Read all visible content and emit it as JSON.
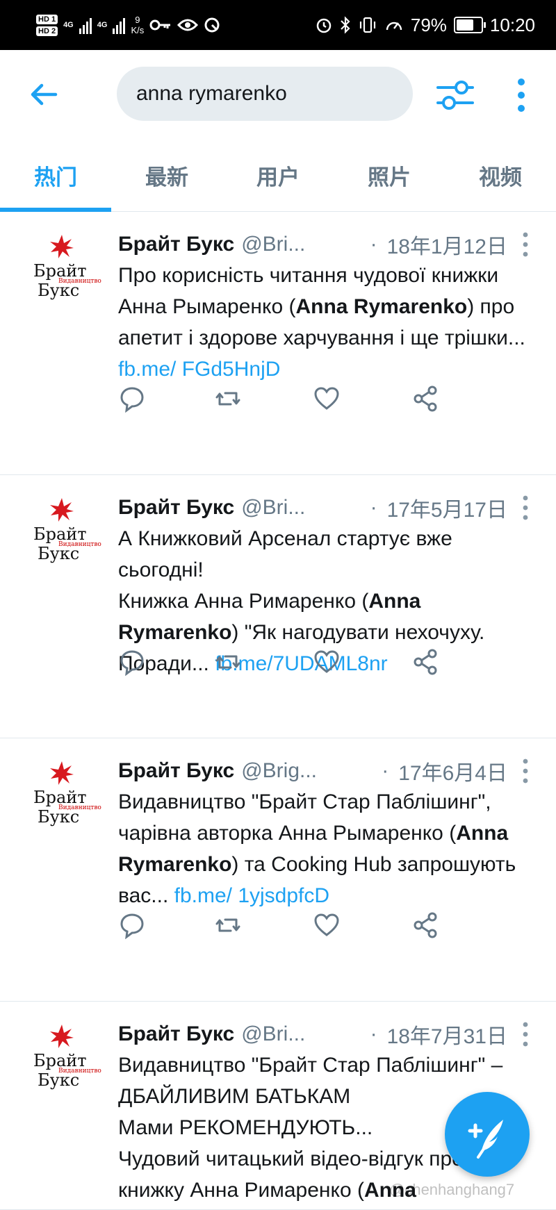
{
  "status_bar": {
    "sim1": "HD 1",
    "sim2": "HD 2",
    "net1": "4G",
    "net2": "4G",
    "speed_value": "9",
    "speed_unit": "K/s",
    "battery": "79%",
    "battery_level": 0.79,
    "time": "10:20"
  },
  "header": {
    "search_value": "anna rymarenko"
  },
  "tabs": [
    "热门",
    "最新",
    "用户",
    "照片",
    "视频"
  ],
  "tweets": [
    {
      "name": "Брайт Букс",
      "handle": "@Bri...",
      "dot": "·",
      "date": "18年1月12日",
      "text_a": "Про корисність читання чудової книжки Анна Рымаренко (",
      "bold": "Anna Rymarenko",
      "text_b": ") про апетит і здорове харчування і ще трішки... ",
      "link": "fb.me/ FGd5HnjD"
    },
    {
      "name": "Брайт Букс",
      "handle": "@Bri...",
      "dot": "·",
      "date": "17年5月17日",
      "text_a": "А Книжковий Арсенал стартує вже сьогодні!\nКнижка Анна Римаренко (",
      "bold": "Anna Rymarenko",
      "text_b": ") \"Як нагодувати нехочуху. Поради... ",
      "link": "fb.me/7UDAML8nr"
    },
    {
      "name": "Брайт Букс",
      "handle": "@Brig...",
      "dot": "·",
      "date": "17年6月4日",
      "text_a": "Видавництво \"Брайт Стар Паблішинг\", чарівна авторка Анна Рымаренко (",
      "bold": "Anna Rymarenko",
      "text_b": ") та Cooking Hub запрошують вас... ",
      "link": "fb.me/ 1yjsdpfcD"
    },
    {
      "name": "Брайт Букс",
      "handle": "@Bri...",
      "dot": "·",
      "date": "18年7月31日",
      "text_a": "Видавництво \"Брайт Стар Паблішинг\" – ДБАЙЛИВИМ БАТЬКАМ\nМами РЕКОМЕНДУЮТЬ...\nЧудовий читацький відео-відгук про книжку Анна Римаренко (",
      "bold": "Anna",
      "text_b": "",
      "link": ""
    }
  ],
  "avatar": {
    "line1": "Брайт",
    "line2": "Букс",
    "sub": "Видавництво",
    "star_color": "#d7191f"
  },
  "icons": {
    "back": "arrow-left-icon",
    "filter": "filter-sliders-icon",
    "more": "more-vertical-icon",
    "reply": "reply-icon",
    "retweet": "retweet-icon",
    "like": "heart-icon",
    "share": "share-icon",
    "compose": "compose-tweet-icon"
  },
  "colors": {
    "accent": "#1da1f2",
    "text": "#14171a",
    "secondary": "#657786"
  },
  "watermark": "@chenhanghang7"
}
